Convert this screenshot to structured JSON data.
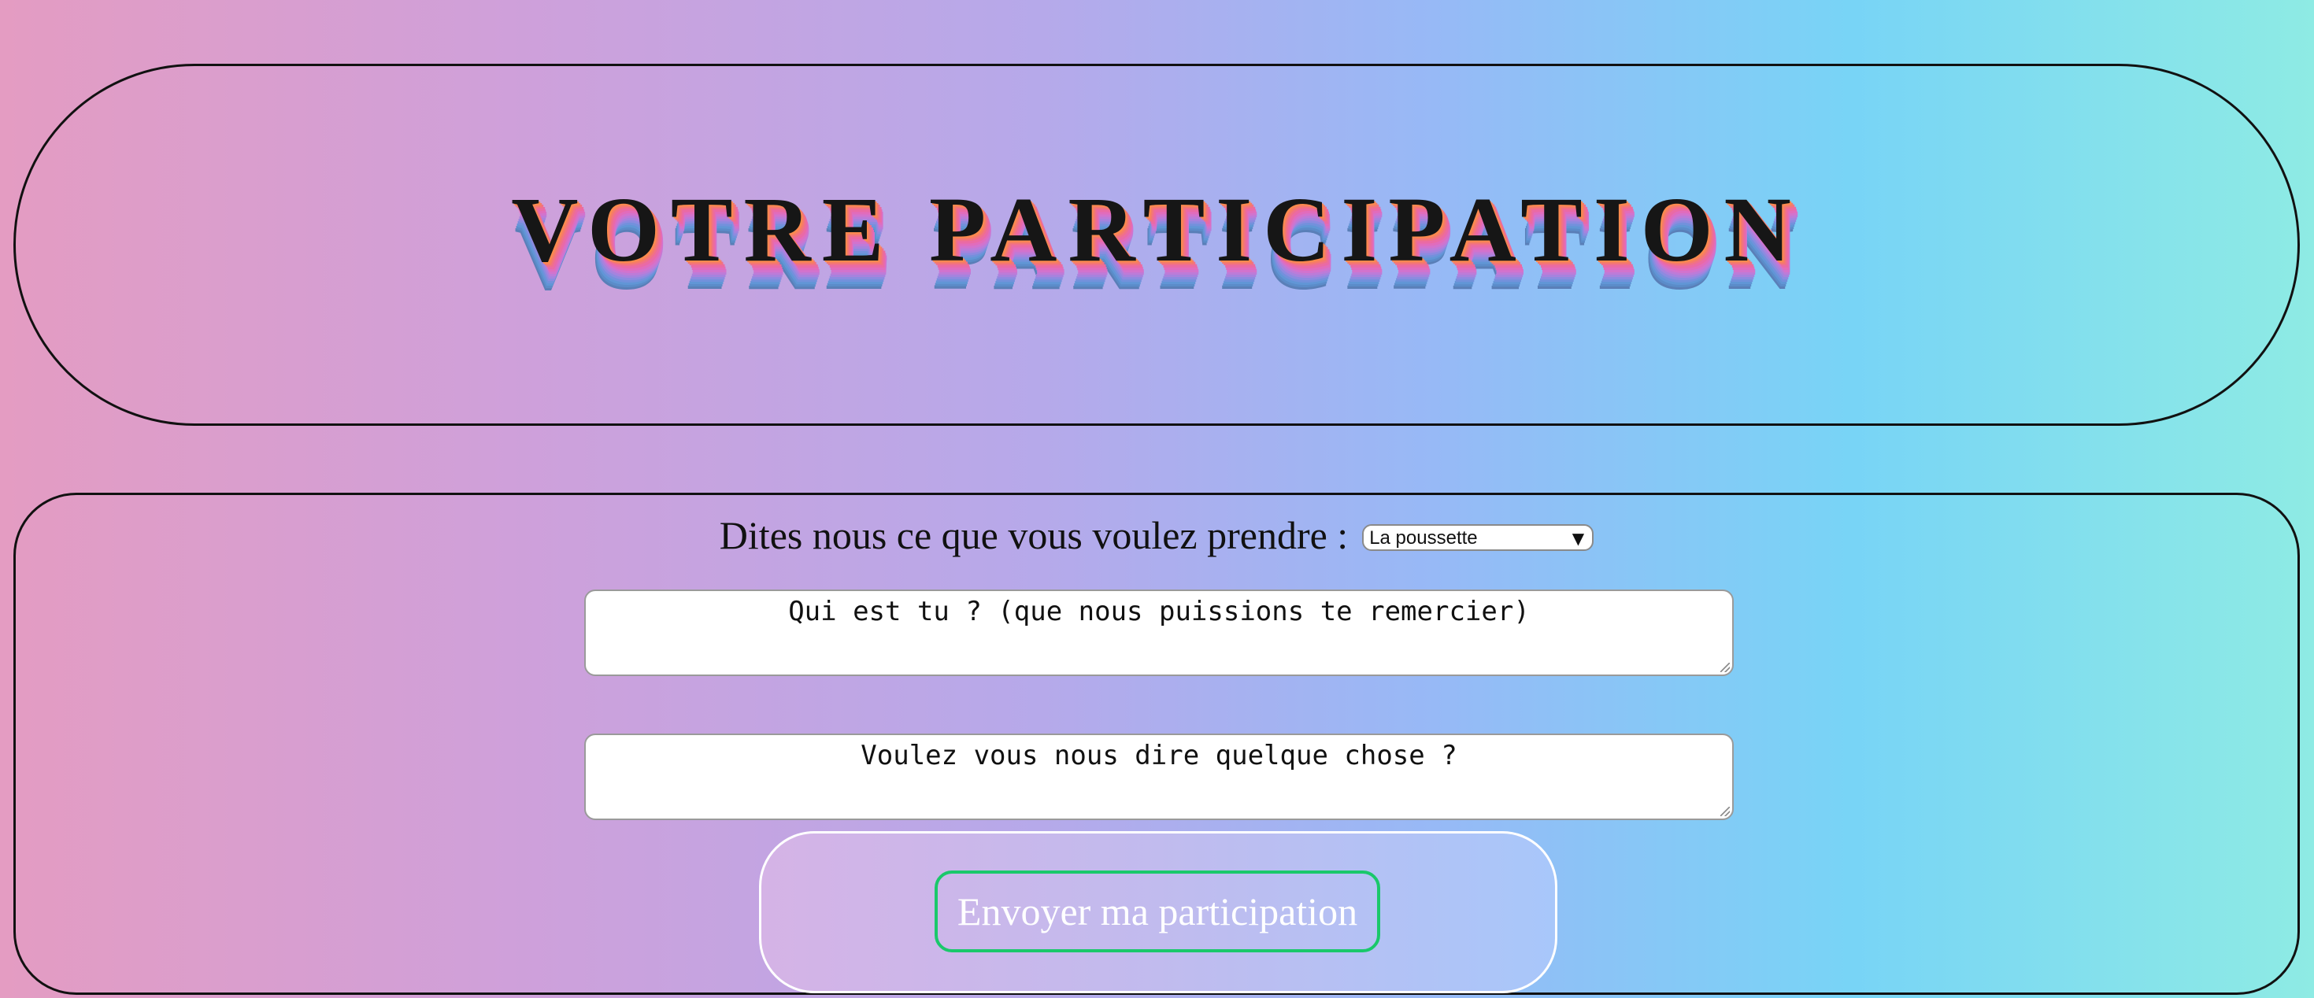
{
  "header": {
    "title": "VOTRE PARTICIPATION"
  },
  "form": {
    "question_label": "Dites nous ce que vous voulez prendre :",
    "item_select": {
      "selected": "La poussette",
      "arrow": "▼"
    },
    "name_field": {
      "value": "Qui est tu ? (que nous puissions te remercier)"
    },
    "message_field": {
      "value": "Voulez vous nous dire quelque chose ?"
    },
    "submit_label": "Envoyer ma participation"
  },
  "colors": {
    "background_start": "#e49cc2",
    "background_end": "#8eebe4",
    "title_text": "#161616",
    "submit_border": "#1ac86b",
    "submit_text": "#ffffff"
  }
}
